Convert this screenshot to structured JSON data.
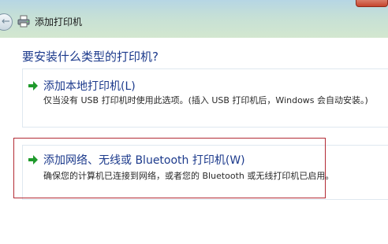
{
  "window": {
    "title": "添加打印机",
    "back_glyph": "←",
    "icons": {
      "back": "back-arrow-icon",
      "printer": "printer-icon",
      "close": "close-icon",
      "option_arrow": "green-arrow-icon"
    }
  },
  "page": {
    "heading": "要安装什么类型的打印机?"
  },
  "options": {
    "local": {
      "title": "添加本地打印机(L)",
      "description": "仅当没有 USB 打印机时使用此选项。(插入 USB 打印机后，Windows 会自动安装。)"
    },
    "network": {
      "title": "添加网络、无线或 Bluetooth 打印机(W)",
      "description": "确保您的计算机已连接到网络，或者您的 Bluetooth 或无线打印机已启用。"
    }
  },
  "colors": {
    "heading_blue": "#1c3a8c",
    "arrow_green": "#1f9a2c",
    "highlight_red": "#b32b35"
  }
}
